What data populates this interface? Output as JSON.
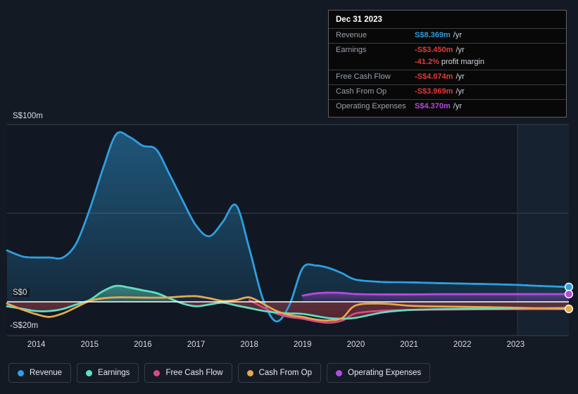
{
  "page": {
    "background": "#141a23"
  },
  "tooltip": {
    "title": "Dec 31 2023",
    "rows": [
      {
        "key": "Revenue",
        "value": "S$8.369m",
        "unit": "/yr",
        "color": "#2e9bd6"
      },
      {
        "key": "Earnings",
        "value": "-S$3.450m",
        "unit": "/yr",
        "color": "#e03a34"
      },
      {
        "key": "",
        "value": "-41.2%",
        "unit": "profit margin",
        "color": "#e03a34"
      },
      {
        "key": "Free Cash Flow",
        "value": "-S$4.074m",
        "unit": "/yr",
        "color": "#e03a34"
      },
      {
        "key": "Cash From Op",
        "value": "-S$3.969m",
        "unit": "/yr",
        "color": "#e03a34"
      },
      {
        "key": "Operating Expenses",
        "value": "S$4.370m",
        "unit": "/yr",
        "color": "#b44be0"
      }
    ]
  },
  "legend": {
    "items": [
      {
        "label": "Revenue",
        "color": "#2f9fe0"
      },
      {
        "label": "Earnings",
        "color": "#5fe0c0"
      },
      {
        "label": "Free Cash Flow",
        "color": "#d94a83"
      },
      {
        "label": "Cash From Op",
        "color": "#e8a84e"
      },
      {
        "label": "Operating Expenses",
        "color": "#b44be0"
      }
    ]
  },
  "axes": {
    "y_labels": [
      {
        "text": "S$100m",
        "value": 100
      },
      {
        "text": "S$0",
        "value": 0
      },
      {
        "text": "-S$20m",
        "value": -20
      }
    ],
    "x_labels": [
      "2014",
      "2015",
      "2016",
      "2017",
      "2018",
      "2019",
      "2020",
      "2021",
      "2022",
      "2023"
    ]
  },
  "chart_data": {
    "type": "area",
    "title": "",
    "xlabel": "",
    "ylabel": "S$ millions",
    "ylim": [
      -20,
      100
    ],
    "grid": true,
    "legend_position": "bottom",
    "currency": "S$",
    "units": "millions per year",
    "x": [
      2013.45,
      2013.75,
      2014.0,
      2014.25,
      2014.5,
      2014.75,
      2015.0,
      2015.25,
      2015.5,
      2015.75,
      2016.0,
      2016.25,
      2016.5,
      2016.75,
      2017.0,
      2017.25,
      2017.5,
      2017.75,
      2018.0,
      2018.25,
      2018.5,
      2018.75,
      2019.0,
      2019.25,
      2019.5,
      2019.75,
      2020.0,
      2020.5,
      2021.0,
      2021.5,
      2022.0,
      2022.5,
      2023.0,
      2023.5,
      2024.0
    ],
    "series": [
      {
        "name": "Revenue",
        "color": "#2f9fe0",
        "filled": true,
        "values": [
          29.0,
          25.5,
          25.0,
          25.0,
          25.0,
          33.0,
          52.0,
          75.0,
          94.5,
          93.0,
          88.0,
          86.0,
          72.0,
          57.0,
          43.0,
          37.0,
          45.0,
          54.5,
          30.0,
          2.0,
          -11.0,
          -2.0,
          19.0,
          20.5,
          19.0,
          16.0,
          12.5,
          11.2,
          11.0,
          10.6,
          10.3,
          10.0,
          9.6,
          8.9,
          8.369
        ]
      },
      {
        "name": "Earnings",
        "color": "#5fe0c0",
        "filled": true,
        "values": [
          -2.5,
          -4.0,
          -5.2,
          -5.2,
          -4.0,
          -1.5,
          1.0,
          6.0,
          9.0,
          8.0,
          6.5,
          5.0,
          2.0,
          -1.0,
          -2.5,
          -1.5,
          -0.5,
          -2.0,
          -3.5,
          -5.0,
          -6.0,
          -6.5,
          -6.8,
          -8.0,
          -9.2,
          -9.5,
          -9.0,
          -6.0,
          -4.6,
          -4.2,
          -4.0,
          -3.9,
          -3.8,
          -3.6,
          -3.45
        ]
      },
      {
        "name": "Free Cash Flow",
        "color": "#d94a83",
        "filled": false,
        "values": [
          null,
          null,
          null,
          null,
          null,
          null,
          null,
          null,
          null,
          null,
          null,
          null,
          null,
          null,
          null,
          null,
          null,
          null,
          1.0,
          -3.0,
          -6.5,
          -8.5,
          -9.5,
          -11.0,
          -11.8,
          -10.5,
          -6.5,
          -5.0,
          -4.6,
          -4.4,
          -4.3,
          -4.2,
          -4.1,
          -4.08,
          -4.074
        ]
      },
      {
        "name": "Cash From Op",
        "color": "#e8a84e",
        "filled": false,
        "values": [
          -1.0,
          -4.5,
          -7.0,
          -8.5,
          -6.5,
          -3.0,
          0.5,
          2.0,
          2.5,
          2.5,
          2.4,
          2.3,
          2.5,
          3.0,
          3.2,
          2.0,
          0.5,
          1.0,
          2.5,
          -1.0,
          -5.0,
          -7.5,
          -8.5,
          -10.0,
          -10.5,
          -9.0,
          -2.0,
          -1.0,
          -2.2,
          -2.6,
          -2.8,
          -3.0,
          -3.3,
          -3.7,
          -3.969
        ]
      },
      {
        "name": "Operating Expenses",
        "color": "#b44be0",
        "filled": true,
        "values": [
          null,
          null,
          null,
          null,
          null,
          null,
          null,
          null,
          null,
          null,
          null,
          null,
          null,
          null,
          null,
          null,
          null,
          null,
          null,
          null,
          null,
          null,
          3.5,
          4.8,
          5.2,
          5.0,
          4.4,
          4.2,
          4.2,
          4.3,
          4.3,
          4.35,
          4.35,
          4.36,
          4.37
        ]
      }
    ],
    "end_markers": [
      {
        "name": "Revenue",
        "value": 8.369,
        "color": "#2f9fe0"
      },
      {
        "name": "Operating Expenses",
        "value": 4.37,
        "color": "#b44be0"
      },
      {
        "name": "Cash From Op",
        "value": -3.969,
        "color": "#e8a84e"
      }
    ]
  }
}
